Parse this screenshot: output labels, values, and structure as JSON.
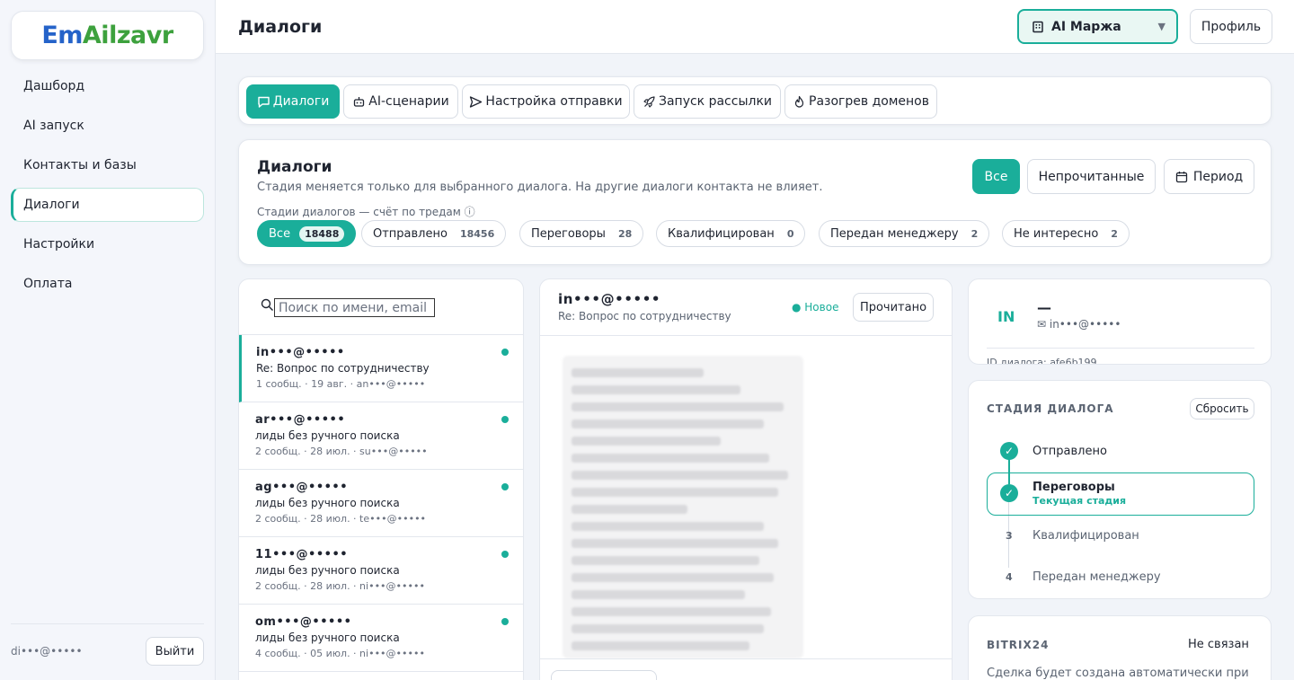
{
  "logo": {
    "part1": "Em",
    "part2": "Ai",
    "part3": "lzavr"
  },
  "sidebar": {
    "items": [
      {
        "label": "Дашборд"
      },
      {
        "label": "AI запуск"
      },
      {
        "label": "Контакты и базы"
      },
      {
        "label": "Диалоги"
      },
      {
        "label": "Настройки"
      },
      {
        "label": "Оплата"
      }
    ],
    "user_email": "di•••@•••••",
    "logout_label": "Выйти"
  },
  "header": {
    "title": "Диалоги",
    "workspace": "AI Маржа",
    "profile_label": "Профиль"
  },
  "tabs": [
    {
      "label": "Диалоги",
      "icon": "chat-icon"
    },
    {
      "label": "AI-сценарии",
      "icon": "robot-icon"
    },
    {
      "label": "Настройка отправки",
      "icon": "send-icon"
    },
    {
      "label": "Запуск рассылки",
      "icon": "rocket-icon"
    },
    {
      "label": "Разогрев доменов",
      "icon": "flame-icon"
    }
  ],
  "filters": {
    "title": "Диалоги",
    "subtitle": "Стадия меняется только для выбранного диалога. На другие диалоги контакта не влияет.",
    "stages_label": "Стадии диалогов — счёт по тредам ⓘ",
    "all_label": "Все",
    "unread_label": "Непрочитанные",
    "period_label": "Период",
    "stage_pills": [
      {
        "label": "Все",
        "count": "18488"
      },
      {
        "label": "Отправлено",
        "count": "18456"
      },
      {
        "label": "Переговоры",
        "count": "28"
      },
      {
        "label": "Квалифицирован",
        "count": "0"
      },
      {
        "label": "Передан менеджеру",
        "count": "2"
      },
      {
        "label": "Не интересно",
        "count": "2"
      }
    ]
  },
  "search": {
    "placeholder": "Поиск по имени, email"
  },
  "dialogs": [
    {
      "from": "in•••@•••••",
      "subject": "Re: Вопрос по сотрудничеству",
      "meta": "1 сообщ. · 19 авг. · an•••@•••••"
    },
    {
      "from": "ar•••@•••••",
      "subject": "лиды без ручного поиска",
      "meta": "2 сообщ. · 28 июл. · su•••@•••••"
    },
    {
      "from": "ag•••@•••••",
      "subject": "лиды без ручного поиска",
      "meta": "2 сообщ. · 28 июл. · te•••@•••••"
    },
    {
      "from": "11•••@•••••",
      "subject": "лиды без ручного поиска",
      "meta": "2 сообщ. · 28 июл. · ni•••@•••••"
    },
    {
      "from": "om•••@•••••",
      "subject": "лиды без ручного поиска",
      "meta": "4 сообщ. · 05 июл. · ni•••@•••••"
    }
  ],
  "message": {
    "from": "in•••@•••••",
    "subject": "Re: Вопрос по сотрудничеству",
    "status": "● Новое",
    "read_label": "Прочитано"
  },
  "contact": {
    "initials": "IN",
    "name": "—",
    "email": "✉ in•••@•••••",
    "dialog_id": "ID диалога: afe6b199"
  },
  "stage": {
    "title": "СТАДИЯ ДИАЛОГА",
    "reset_label": "Сбросить",
    "items": [
      {
        "label": "Отправлено"
      },
      {
        "label": "Переговоры",
        "note": "Текущая стадия"
      },
      {
        "num": "3",
        "label": "Квалифицирован"
      },
      {
        "num": "4",
        "label": "Передан менеджеру"
      }
    ]
  },
  "bitrix": {
    "title": "BITRIX24",
    "status": "Не связан",
    "desc": "Сделка будет создана автоматически при"
  },
  "colors": {
    "accent": "#1aae9a",
    "logo_blue": "#2563c9",
    "logo_green": "#3da13d"
  }
}
